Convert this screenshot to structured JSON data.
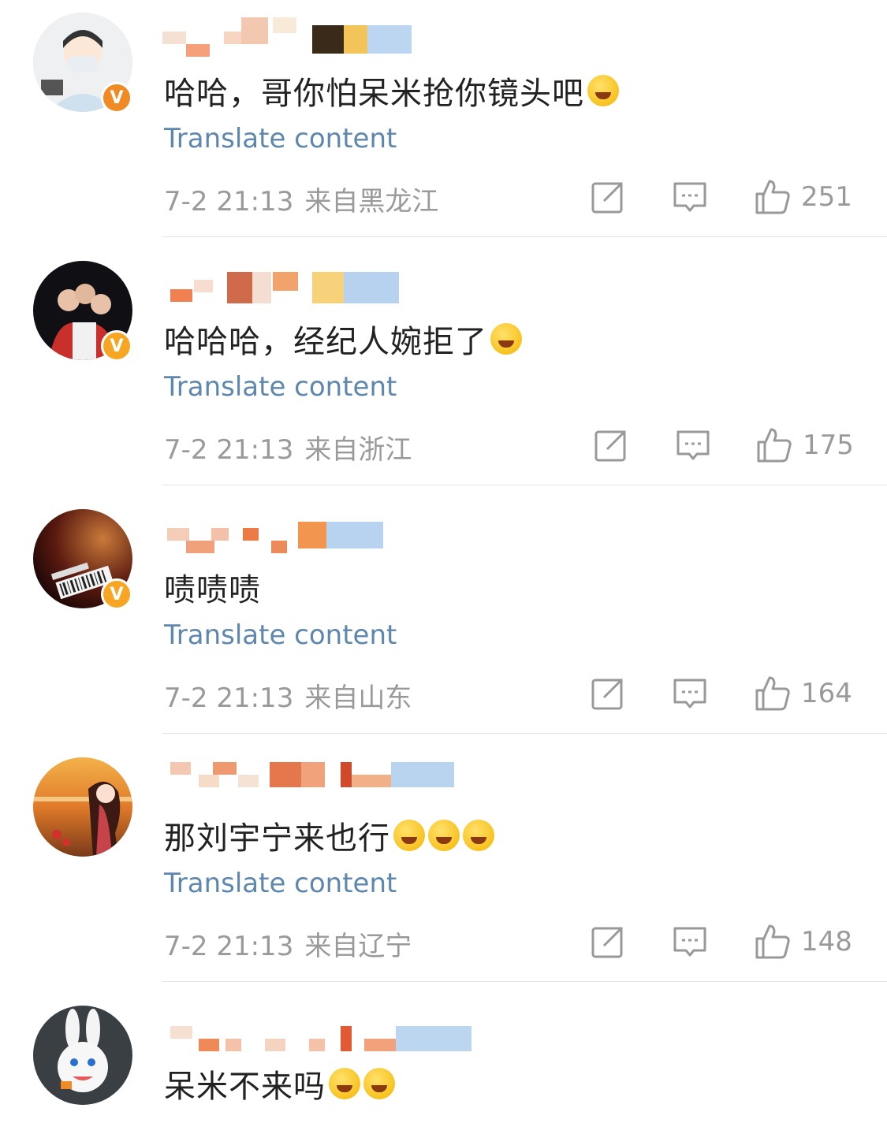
{
  "comments": [
    {
      "text": "哈哈，哥你怕呆米抢你镜头吧",
      "emoji": [
        "grin-emoji"
      ],
      "translate_label": "Translate content",
      "time": "7-2 21:13",
      "location": "来自黑龙江",
      "likes": "251",
      "badge_color": "#f08a24"
    },
    {
      "text": "哈哈哈，经纪人婉拒了",
      "emoji": [
        "laugh-cry-emoji"
      ],
      "translate_label": "Translate content",
      "time": "7-2 21:13",
      "location": "来自浙江",
      "likes": "175",
      "badge_color": "#f6b428"
    },
    {
      "text": "啧啧啧",
      "emoji": [],
      "translate_label": "Translate content",
      "time": "7-2 21:13",
      "location": "来自山东",
      "likes": "164",
      "badge_color": "#f6b428"
    },
    {
      "text": "那刘宇宁来也行",
      "emoji": [
        "crying-emoji",
        "crying-emoji",
        "crying-emoji"
      ],
      "translate_label": "Translate content",
      "time": "7-2 21:13",
      "location": "来自辽宁",
      "likes": "148",
      "badge_color": ""
    },
    {
      "text": "呆米不来吗",
      "emoji": [
        "sad-emoji",
        "pleading-emoji"
      ],
      "translate_label": "",
      "time": "",
      "location": "",
      "likes": "",
      "badge_color": ""
    }
  ]
}
